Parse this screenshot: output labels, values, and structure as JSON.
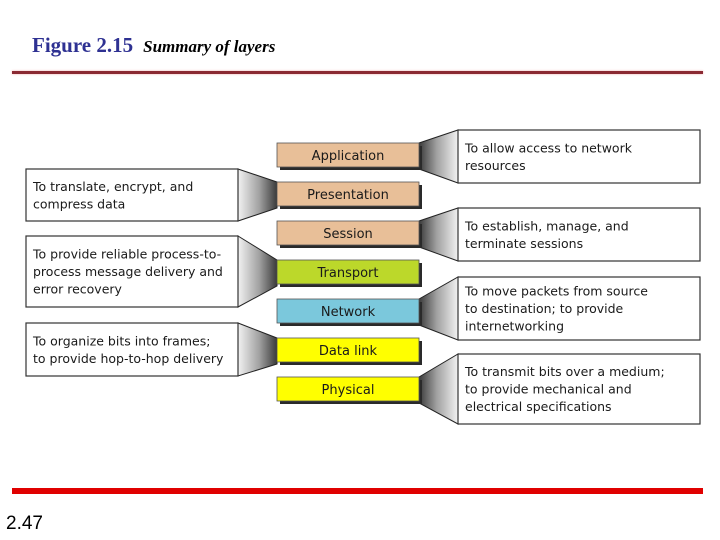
{
  "slide": {
    "figure_number": "Figure 2.15",
    "figure_caption": "Summary of layers",
    "page_number": "2.47"
  },
  "colors": {
    "title_blue": "#2e3192",
    "top_rule": "#8b2a33",
    "bottom_rule": "#e00000",
    "upper_layers": "#e8bf98",
    "transport": "#bcd82a",
    "network": "#7bc8dc",
    "lower_layers": "#ffff00"
  },
  "layers": [
    {
      "name": "Application",
      "color": "#e8bf98",
      "side": "right",
      "description": [
        "To allow access to network",
        "resources"
      ]
    },
    {
      "name": "Presentation",
      "color": "#e8bf98",
      "side": "left",
      "description": [
        "To translate, encrypt, and",
        "compress data"
      ]
    },
    {
      "name": "Session",
      "color": "#e8bf98",
      "side": "right",
      "description": [
        "To establish, manage, and",
        "terminate sessions"
      ]
    },
    {
      "name": "Transport",
      "color": "#bcd82a",
      "side": "left",
      "description": [
        "To provide reliable process-to-",
        "process message delivery and",
        "error recovery"
      ]
    },
    {
      "name": "Network",
      "color": "#7bc8dc",
      "side": "right",
      "description": [
        "To move packets from source",
        "to destination; to provide",
        "internetworking"
      ]
    },
    {
      "name": "Data link",
      "color": "#ffff00",
      "side": "left",
      "description": [
        "To organize bits into frames;",
        "to provide hop-to-hop delivery"
      ]
    },
    {
      "name": "Physical",
      "color": "#ffff00",
      "side": "right",
      "description": [
        "To transmit bits over a medium;",
        "to provide mechanical and",
        "electrical specifications"
      ]
    }
  ]
}
